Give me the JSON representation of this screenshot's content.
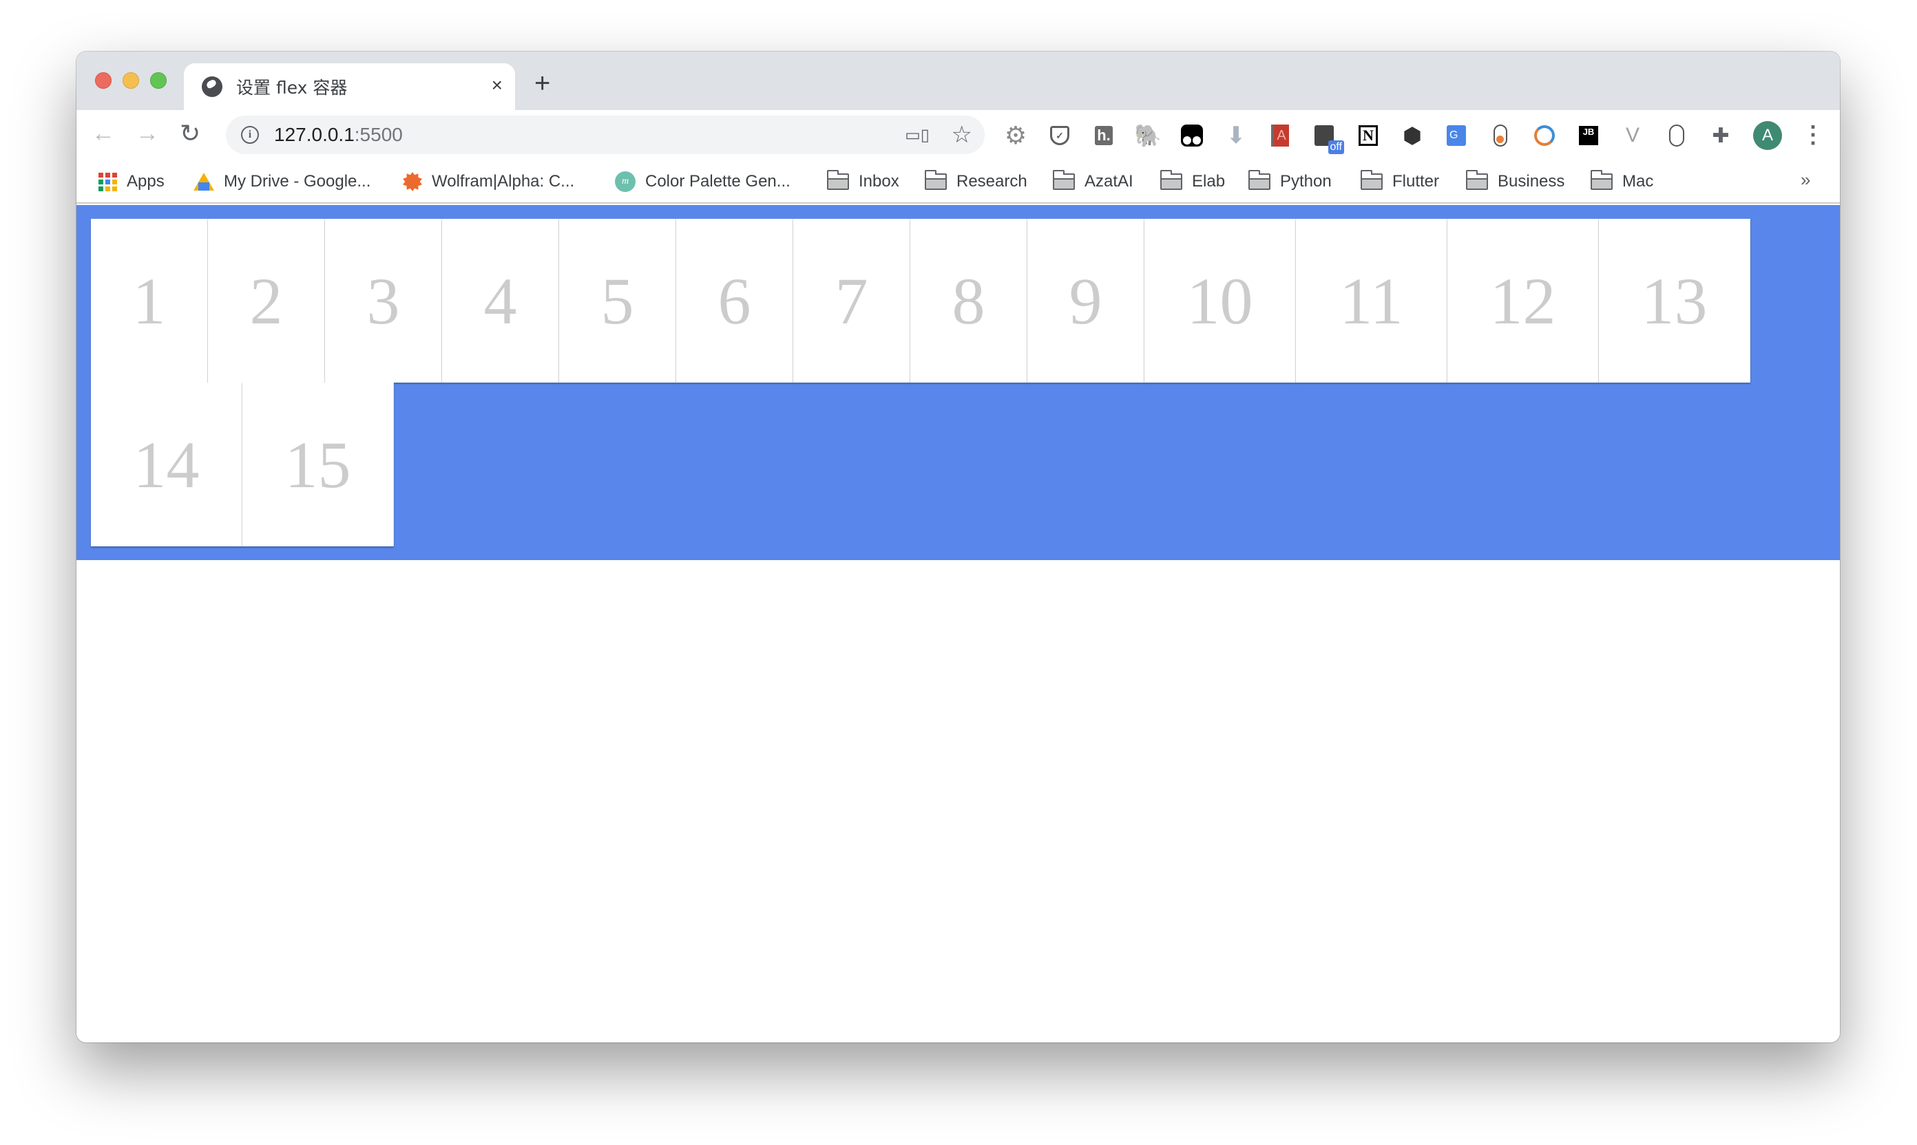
{
  "browser": {
    "tab": {
      "title": "设置 flex 容器",
      "favicon": "globe-icon",
      "close_icon": "×"
    },
    "new_tab_icon": "+",
    "nav": {
      "back_icon": "←",
      "forward_icon": "→",
      "reload_icon": "↻"
    },
    "address_bar": {
      "host": "127.0.0.1",
      "port": ":5500",
      "info_icon": "i",
      "cast_icon": "devices-icon",
      "bookmark_icon": "☆"
    },
    "extensions": [
      "settings-gear",
      "pocket",
      "hypothesis",
      "evernote",
      "tampermonkey",
      "downloader",
      "reader",
      "off-extension",
      "notion",
      "cube",
      "google-translate",
      "pill-toggle",
      "sync",
      "jetbrains",
      "vue-devtools",
      "mouse",
      "extensions-puzzle"
    ],
    "extension_labels": {
      "gear": "⚙",
      "hypothesis": "h.",
      "evernote": "🐘",
      "download": "⬇",
      "reader": "A",
      "off_badge": "off",
      "notion": "N",
      "cube": "⬢",
      "translate": "G",
      "jb": "JB",
      "vue": "V",
      "puzzle": "✚",
      "pocket": "✓"
    },
    "profile_avatar": "A",
    "menu_icon": "⋮",
    "bookmarks": [
      {
        "label": "Apps",
        "icon": "apps-grid-icon"
      },
      {
        "label": "My Drive - Google...",
        "icon": "google-drive-icon"
      },
      {
        "label": "Wolfram|Alpha: C...",
        "icon": "wolfram-icon"
      },
      {
        "label": "Color Palette Gen...",
        "icon": "palette-icon"
      },
      {
        "label": "Inbox",
        "icon": "folder-icon"
      },
      {
        "label": "Research",
        "icon": "folder-icon"
      },
      {
        "label": "AzatAI",
        "icon": "folder-icon"
      },
      {
        "label": "Elab",
        "icon": "folder-icon"
      },
      {
        "label": "Python",
        "icon": "folder-icon"
      },
      {
        "label": "Flutter",
        "icon": "folder-icon"
      },
      {
        "label": "Business",
        "icon": "folder-icon"
      },
      {
        "label": "Mac",
        "icon": "folder-icon"
      }
    ],
    "bookmarks_overflow": "»",
    "palette_letter": "m"
  },
  "page": {
    "container_color": "#5886ea",
    "item_text_color": "#cccccc",
    "items": [
      "1",
      "2",
      "3",
      "4",
      "5",
      "6",
      "7",
      "8",
      "9",
      "10",
      "11",
      "12",
      "13",
      "14",
      "15"
    ]
  }
}
